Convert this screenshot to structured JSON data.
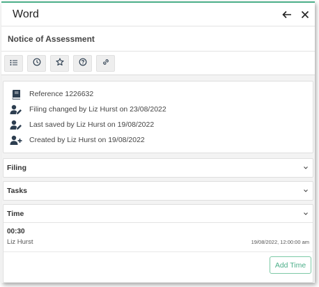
{
  "header": {
    "title": "Word"
  },
  "document": {
    "title": "Notice of Assessment"
  },
  "toolbar": {
    "buttons": [
      {
        "icon": "list-icon"
      },
      {
        "icon": "clock-icon"
      },
      {
        "icon": "star-icon"
      },
      {
        "icon": "help-icon"
      },
      {
        "icon": "link-icon"
      }
    ]
  },
  "info": {
    "reference": "Reference 1226632",
    "filing_changed": "Filing changed by Liz Hurst on 23/08/2022",
    "last_saved": "Last saved by Liz Hurst on 19/08/2022",
    "created": "Created by Liz Hurst on 19/08/2022"
  },
  "sections": {
    "filing": "Filing",
    "tasks": "Tasks",
    "time": "Time"
  },
  "time_entries": [
    {
      "duration": "00:30",
      "user": "Liz Hurst",
      "date": "19/08/2022, 12:00:00 am"
    }
  ],
  "actions": {
    "add_time": "Add Time"
  },
  "colors": {
    "accent": "#4caf89",
    "icon": "#2d3e50"
  }
}
